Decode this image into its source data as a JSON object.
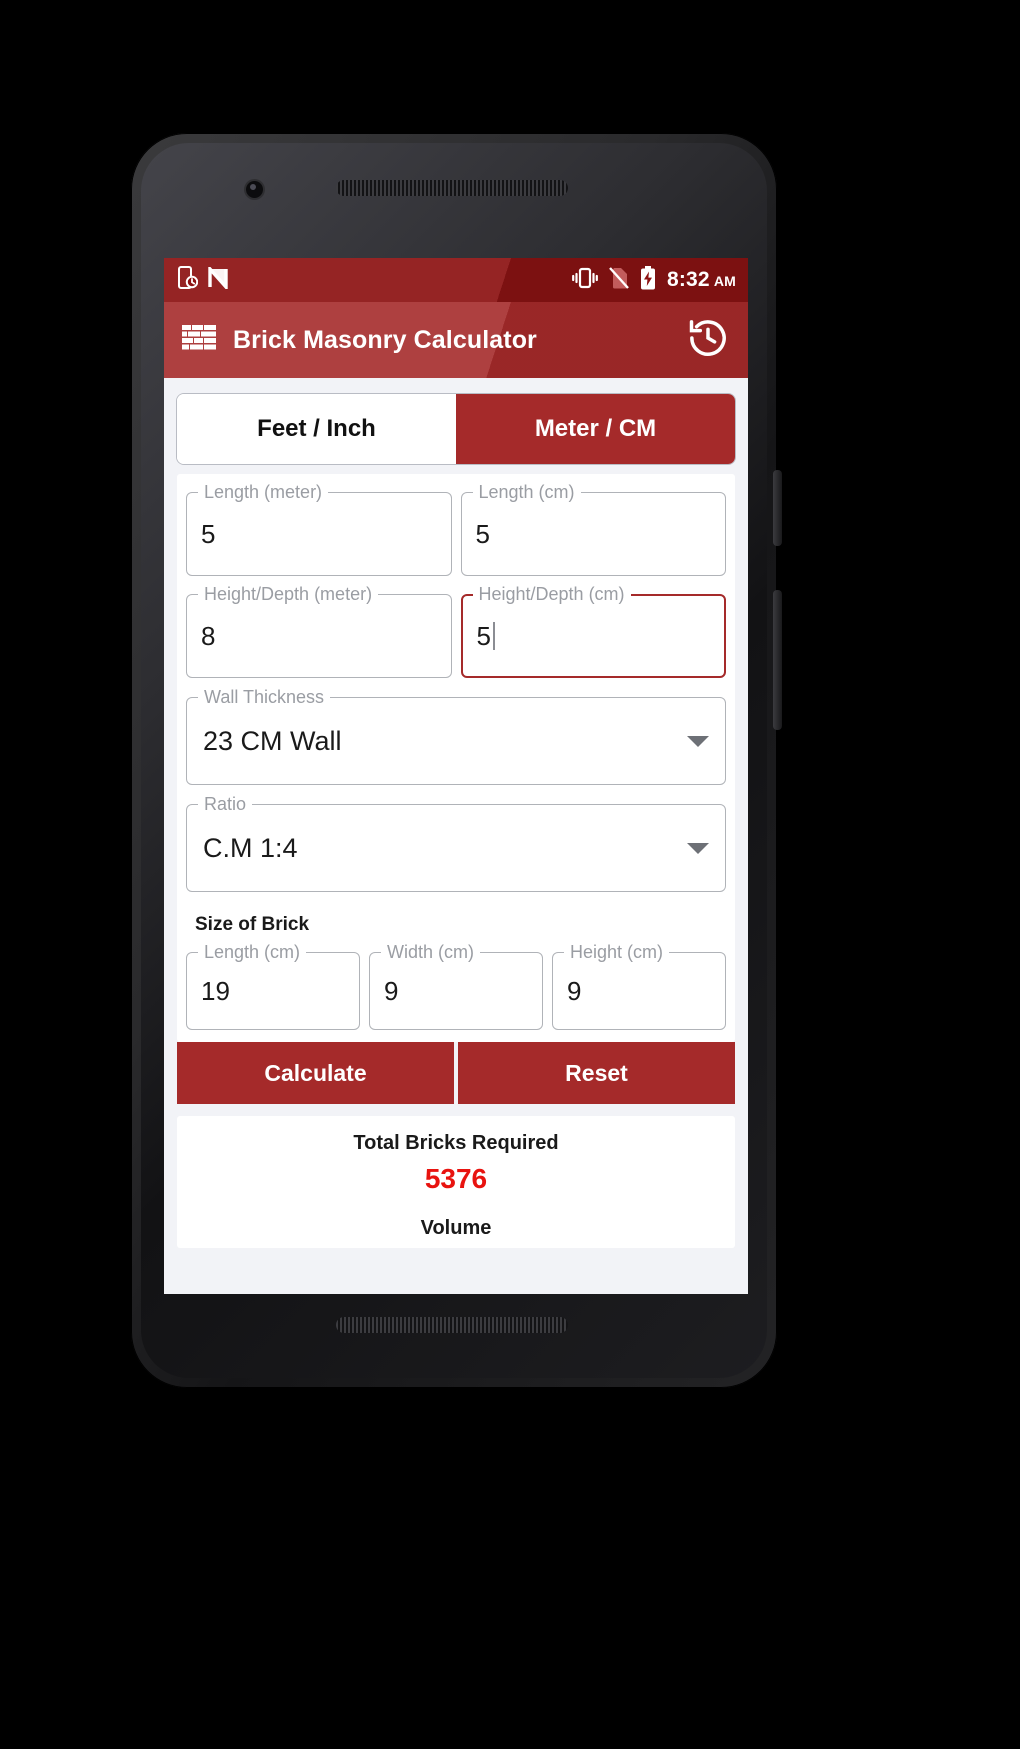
{
  "statusbar": {
    "time": "8:32",
    "ampm": "AM",
    "left_icons": [
      "phone-with-clock-icon",
      "nougat-n-icon"
    ],
    "right_icons": [
      "vibrate-icon",
      "no-sim-icon",
      "battery-charging-icon"
    ]
  },
  "appbar": {
    "icon": "brick-wall-icon",
    "title": "Brick Masonry Calculator",
    "action_icon": "history-icon"
  },
  "tabs": [
    {
      "label": "Feet / Inch",
      "active": false
    },
    {
      "label": "Meter / CM",
      "active": true
    }
  ],
  "fields": {
    "length_meter": {
      "label": "Length (meter)",
      "value": "5"
    },
    "length_cm": {
      "label": "Length (cm)",
      "value": "5"
    },
    "height_meter": {
      "label": "Height/Depth (meter)",
      "value": "8"
    },
    "height_cm": {
      "label": "Height/Depth (cm)",
      "value": "5",
      "focused": true
    }
  },
  "wall_thickness": {
    "label": "Wall Thickness",
    "value": "23 CM Wall"
  },
  "ratio": {
    "label": "Ratio",
    "value": "C.M 1:4"
  },
  "brick": {
    "section_title": "Size of Brick",
    "length": {
      "label": "Length (cm)",
      "value": "19"
    },
    "width": {
      "label": "Width (cm)",
      "value": "9"
    },
    "height": {
      "label": "Height (cm)",
      "value": "9"
    }
  },
  "buttons": {
    "calculate": "Calculate",
    "reset": "Reset"
  },
  "result": {
    "total_label": "Total Bricks Required",
    "total_value": "5376",
    "volume_label": "Volume"
  },
  "navbar": {
    "back": "back-triangle-icon",
    "home": "home-circle-icon",
    "recents": "recents-square-icon"
  },
  "colors": {
    "primary": "#a52a2a",
    "status_bar": "#8d1313",
    "result_value": "#e8130f",
    "page_bg": "#f2f3f7"
  }
}
